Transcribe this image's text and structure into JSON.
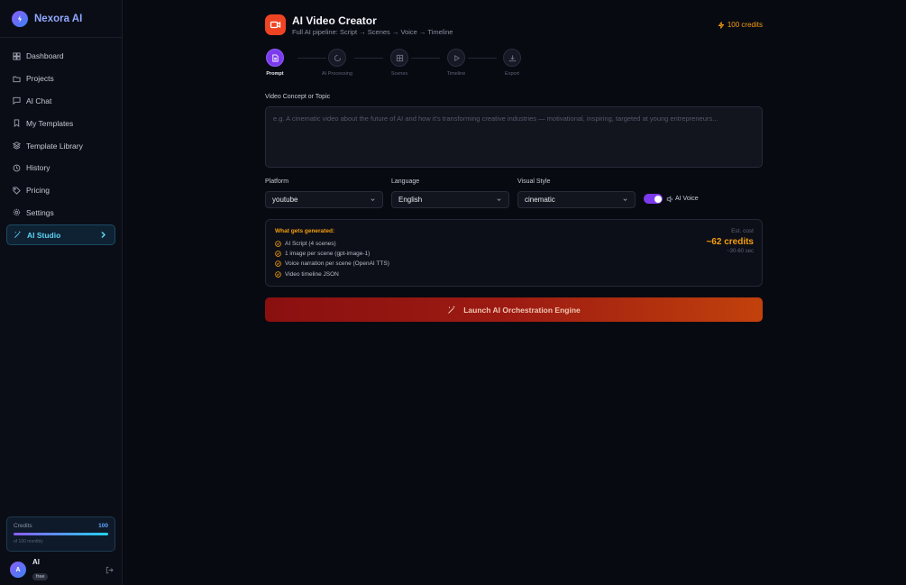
{
  "brand": {
    "name": "Nexora AI"
  },
  "sidebar": {
    "items": [
      {
        "label": "Dashboard",
        "icon": "dashboard-icon"
      },
      {
        "label": "Projects",
        "icon": "folder-icon"
      },
      {
        "label": "AI Chat",
        "icon": "chat-icon"
      },
      {
        "label": "My Templates",
        "icon": "bookmark-icon"
      },
      {
        "label": "Template Library",
        "icon": "layers-icon"
      },
      {
        "label": "History",
        "icon": "history-icon"
      },
      {
        "label": "Pricing",
        "icon": "tag-icon"
      },
      {
        "label": "Settings",
        "icon": "gear-icon"
      },
      {
        "label": "AI Studio",
        "icon": "wand-icon",
        "active": true
      }
    ],
    "credits": {
      "label": "Credits",
      "value": "100",
      "subtitle": "of 100 monthly",
      "fill_fraction": 1.0
    },
    "user": {
      "initial": "A",
      "name": "Al",
      "plan": "free"
    }
  },
  "header": {
    "title": "AI Video Creator",
    "subtitle": "Full AI pipeline: Script → Scenes → Voice → Timeline",
    "credits": "100 credits"
  },
  "steps": [
    {
      "label": "Prompt",
      "icon": "document-icon",
      "active": true
    },
    {
      "label": "AI Processing",
      "icon": "spinner-icon",
      "active": false
    },
    {
      "label": "Scenes",
      "icon": "image-icon",
      "active": false
    },
    {
      "label": "Timeline",
      "icon": "play-icon",
      "active": false
    },
    {
      "label": "Export",
      "icon": "download-icon",
      "active": false
    }
  ],
  "concept": {
    "label": "Video Concept or Topic",
    "placeholder": "e.g. A cinematic video about the future of AI and how it's transforming creative industries — motivational, inspiring, targeted at young entrepreneurs..."
  },
  "options": {
    "platform": {
      "label": "Platform",
      "value": "youtube"
    },
    "language": {
      "label": "Language",
      "value": "English"
    },
    "style": {
      "label": "Visual Style",
      "value": "cinematic"
    },
    "voice": {
      "label": "AI Voice",
      "enabled": true
    }
  },
  "generated": {
    "title": "What gets generated:",
    "items": [
      "AI Script (4 scenes)",
      "1 image per scene (gpt-image-1)",
      "Voice narration per scene (OpenAI TTS)",
      "Video timeline JSON"
    ],
    "cost_label": "Est. cost",
    "cost_value": "~62 credits",
    "cost_time": "~30-60 sec"
  },
  "launch": {
    "label": "Launch AI Orchestration Engine"
  },
  "colors": {
    "accent_purple": "#7c3aed",
    "accent_cyan": "#5fd3f3",
    "accent_orange": "#f59e0b",
    "header_icon": "#ef4423"
  }
}
